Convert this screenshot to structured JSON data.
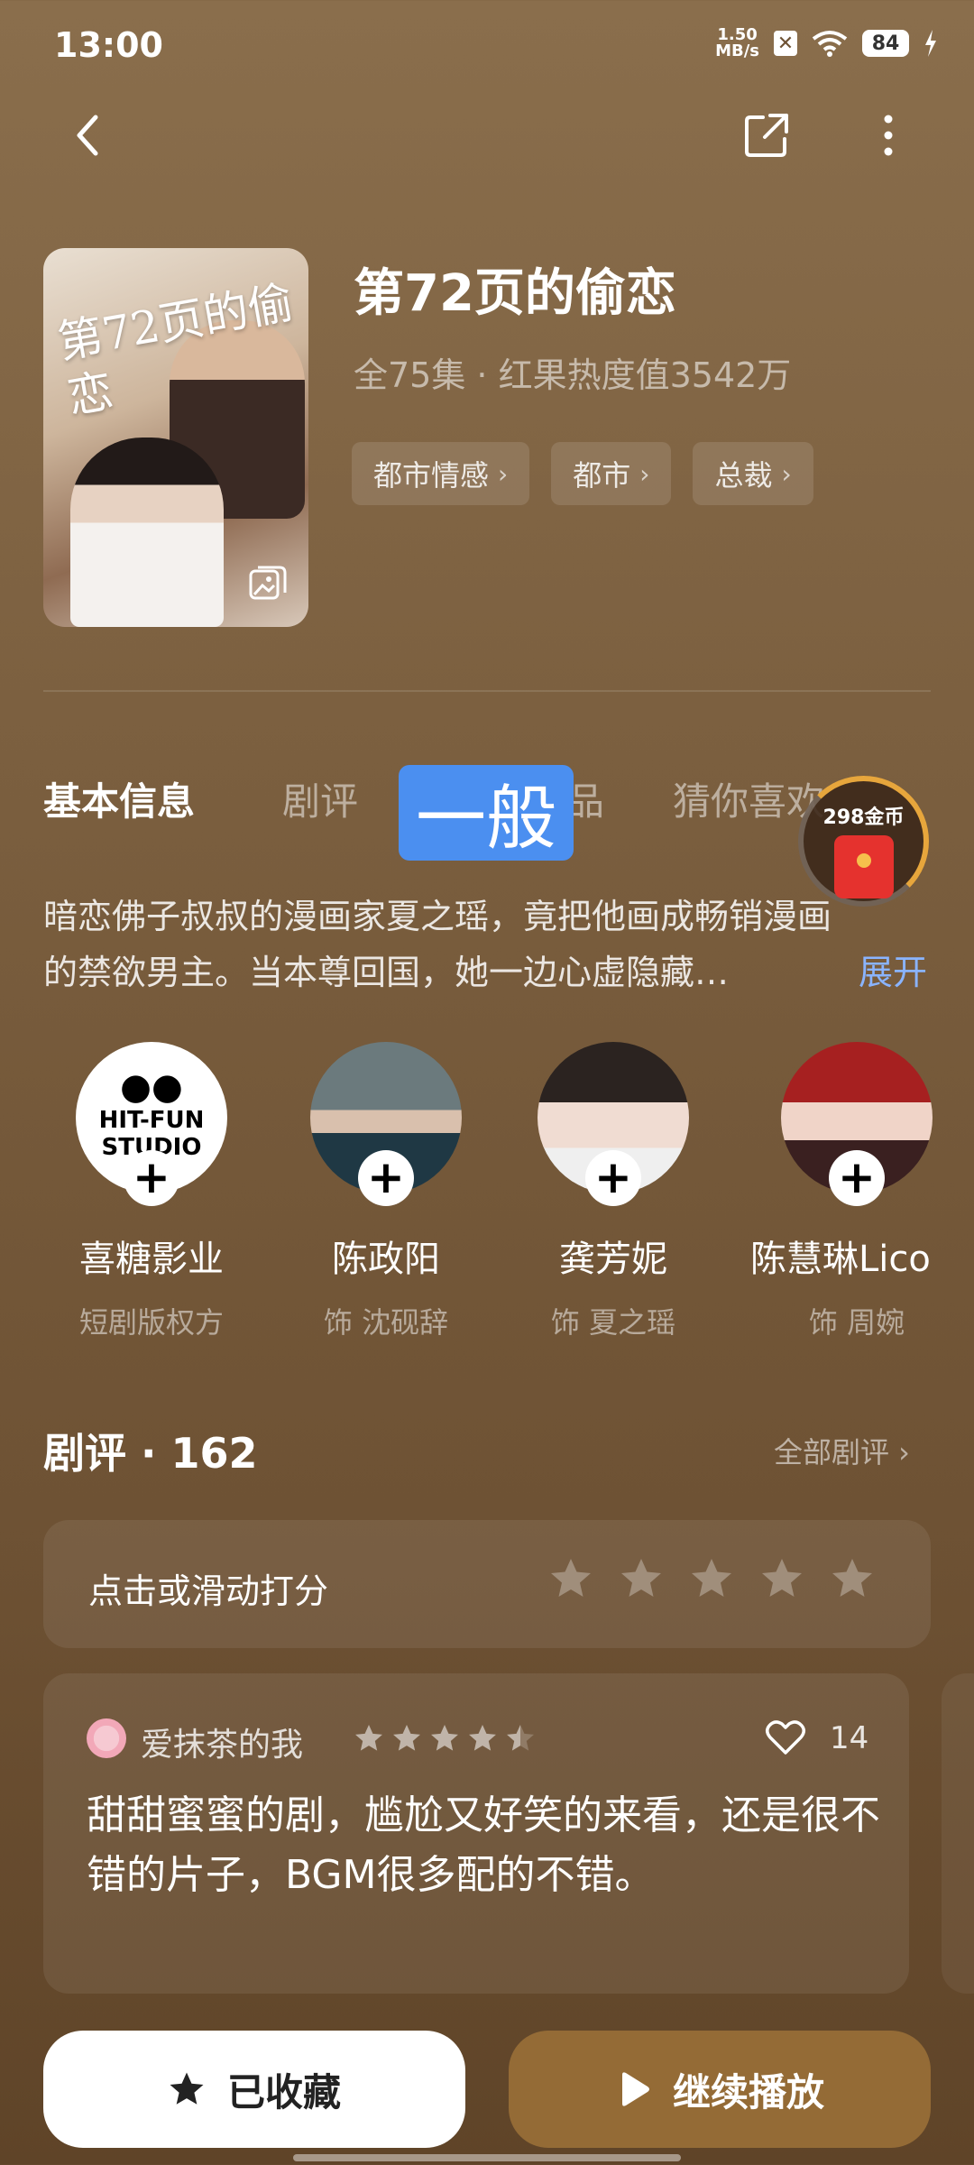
{
  "status_bar": {
    "time": "13:00",
    "net_speed_value": "1.50",
    "net_speed_unit": "MB/s",
    "battery": "84"
  },
  "drama": {
    "title": "第72页的偷恋",
    "meta": "全75集 · 红果热度值3542万",
    "poster_title": "第72页的偷恋",
    "tags": [
      "都市情感",
      "都市",
      "总裁"
    ]
  },
  "tabs": [
    "基本信息",
    "剧评",
    "品",
    "猜你喜欢"
  ],
  "overlay_badge": "一般",
  "coin_widget": {
    "label": "298金币",
    "accent": "#e7a63c"
  },
  "synopsis": {
    "line1": "暗恋佛子叔叔的漫画家夏之瑶，竟把他画成畅销漫画",
    "line2": "的禁欲男主。当本尊回国，她一边心虚隐藏…",
    "expand_label": "展开"
  },
  "cast": [
    {
      "name": "喜糖影业",
      "role": "短剧版权方",
      "logo": "HIT-FUN STUDIO"
    },
    {
      "name": "陈政阳",
      "role": "饰 沈砚辞"
    },
    {
      "name": "龚芳妮",
      "role": "饰 夏之瑶"
    },
    {
      "name": "陈慧琳Lico",
      "role": "饰 周婉"
    }
  ],
  "reviews": {
    "title": "剧评 · 162",
    "all_label": "全部剧评 ›",
    "rate_prompt": "点击或滑动打分",
    "rate_stars": 5,
    "items": [
      {
        "user": "爱抹茶的我",
        "rating": 4.5,
        "likes": "14",
        "text": "甜甜蜜蜜的剧，尴尬又好笑的来看，还是很不错的片子，BGM很多配的不错。"
      }
    ]
  },
  "bottom_bar": {
    "collect_label": "已收藏",
    "play_label": "继续播放",
    "play_color": "#946b36"
  }
}
